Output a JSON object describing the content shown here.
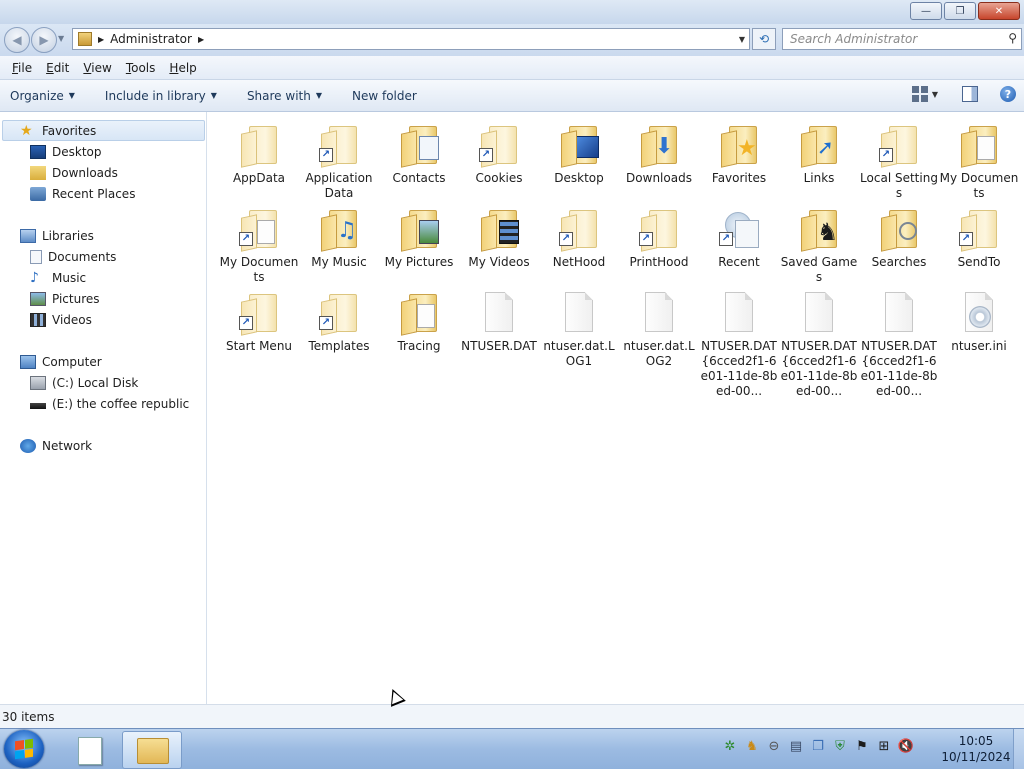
{
  "window": {
    "controls": {
      "minimize": "—",
      "maximize": "❐",
      "close": "✕"
    }
  },
  "nav": {
    "back_icon": "back-arrow-icon",
    "forward_icon": "forward-arrow-icon",
    "address": {
      "crumb": "Administrator"
    },
    "search": {
      "placeholder": "Search Administrator"
    }
  },
  "menu": [
    "File",
    "Edit",
    "View",
    "Tools",
    "Help"
  ],
  "commands": [
    "Organize",
    "Include in library",
    "Share with",
    "New folder"
  ],
  "sidebar": {
    "favorites": {
      "label": "Favorites",
      "items": [
        "Desktop",
        "Downloads",
        "Recent Places"
      ]
    },
    "libraries": {
      "label": "Libraries",
      "items": [
        "Documents",
        "Music",
        "Pictures",
        "Videos"
      ]
    },
    "computer": {
      "label": "Computer",
      "items": [
        "(C:) Local Disk",
        "(E:) the coffee republic"
      ]
    },
    "network": {
      "label": "Network"
    }
  },
  "files": [
    {
      "name": "AppData",
      "kind": "folder-pale",
      "overlay": "",
      "shortcut": false
    },
    {
      "name": "Application Data",
      "kind": "folder-pale",
      "overlay": "",
      "shortcut": true
    },
    {
      "name": "Contacts",
      "kind": "folder",
      "overlay": "card",
      "shortcut": false
    },
    {
      "name": "Cookies",
      "kind": "folder-pale",
      "overlay": "",
      "shortcut": true
    },
    {
      "name": "Desktop",
      "kind": "folder",
      "overlay": "screen",
      "shortcut": false
    },
    {
      "name": "Downloads",
      "kind": "folder",
      "overlay": "arrow",
      "shortcut": false
    },
    {
      "name": "Favorites",
      "kind": "folder",
      "overlay": "star",
      "shortcut": false
    },
    {
      "name": "Links",
      "kind": "folder",
      "overlay": "link",
      "shortcut": false
    },
    {
      "name": "Local Settings",
      "kind": "folder-pale",
      "overlay": "",
      "shortcut": true
    },
    {
      "name": "My Documents",
      "kind": "folder",
      "overlay": "paper",
      "shortcut": false
    },
    {
      "name": "My Documents",
      "kind": "folder-pale",
      "overlay": "paper",
      "shortcut": true
    },
    {
      "name": "My Music",
      "kind": "folder",
      "overlay": "note",
      "shortcut": false
    },
    {
      "name": "My Pictures",
      "kind": "folder",
      "overlay": "photo",
      "shortcut": false
    },
    {
      "name": "My Videos",
      "kind": "folder",
      "overlay": "film",
      "shortcut": false
    },
    {
      "name": "NetHood",
      "kind": "folder-pale",
      "overlay": "",
      "shortcut": true
    },
    {
      "name": "PrintHood",
      "kind": "folder-pale",
      "overlay": "",
      "shortcut": true
    },
    {
      "name": "Recent",
      "kind": "recent",
      "overlay": "",
      "shortcut": true
    },
    {
      "name": "Saved Games",
      "kind": "folder",
      "overlay": "chess",
      "shortcut": false
    },
    {
      "name": "Searches",
      "kind": "folder",
      "overlay": "search",
      "shortcut": false
    },
    {
      "name": "SendTo",
      "kind": "folder-pale",
      "overlay": "",
      "shortcut": true
    },
    {
      "name": "Start Menu",
      "kind": "folder-pale",
      "overlay": "",
      "shortcut": true
    },
    {
      "name": "Templates",
      "kind": "folder-pale",
      "overlay": "",
      "shortcut": true
    },
    {
      "name": "Tracing",
      "kind": "folder",
      "overlay": "paper",
      "shortcut": false
    },
    {
      "name": "NTUSER.DAT",
      "kind": "file",
      "overlay": "",
      "shortcut": false
    },
    {
      "name": "ntuser.dat.LOG1",
      "kind": "file",
      "overlay": "",
      "shortcut": false
    },
    {
      "name": "ntuser.dat.LOG2",
      "kind": "file",
      "overlay": "",
      "shortcut": false
    },
    {
      "name": "NTUSER.DAT{6cced2f1-6e01-11de-8bed-00...",
      "kind": "file",
      "overlay": "",
      "shortcut": false
    },
    {
      "name": "NTUSER.DAT{6cced2f1-6e01-11de-8bed-00...",
      "kind": "file",
      "overlay": "",
      "shortcut": false
    },
    {
      "name": "NTUSER.DAT{6cced2f1-6e01-11de-8bed-00...",
      "kind": "file",
      "overlay": "",
      "shortcut": false
    },
    {
      "name": "ntuser.ini",
      "kind": "ini",
      "overlay": "",
      "shortcut": false
    }
  ],
  "status": {
    "items": "30 items"
  },
  "taskbar": {
    "clock": {
      "time": "10:05",
      "date": "10/11/2024"
    }
  }
}
